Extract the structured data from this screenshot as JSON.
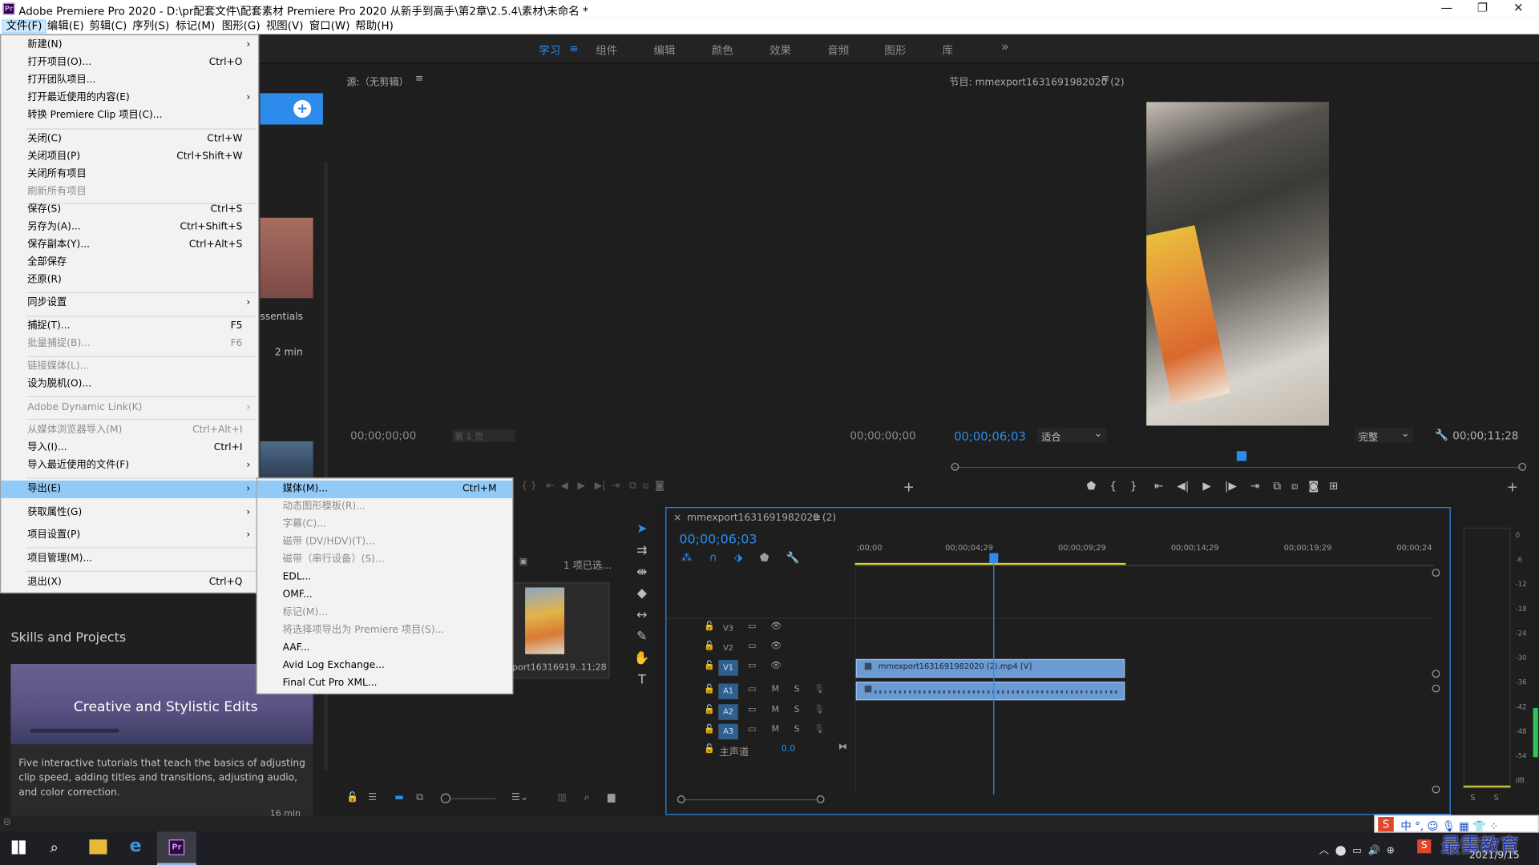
{
  "window": {
    "title": "Adobe Premiere Pro 2020 - D:\\pr配套文件\\配套素材 Premiere Pro 2020 从新手到高手\\第2章\\2.5.4\\素材\\未命名 *",
    "logo": "Pr",
    "minimize": "—",
    "maximize": "❐",
    "close": "✕"
  },
  "menubar": {
    "items": [
      "文件(F)",
      "编辑(E)",
      "剪辑(C)",
      "序列(S)",
      "标记(M)",
      "图形(G)",
      "视图(V)",
      "窗口(W)",
      "帮助(H)"
    ]
  },
  "workspaces": {
    "items": [
      "学习",
      "组件",
      "编辑",
      "颜色",
      "效果",
      "音频",
      "图形",
      "库"
    ],
    "active": "学习",
    "more": "»"
  },
  "learn": {
    "essentials": "ssentials",
    "min1": "2 min",
    "skills_title": "Skills and Projects",
    "card_title": "Creative and Stylistic Edits",
    "card_desc": "Five interactive tutorials that teach the basics of adjusting clip speed, adding titles and transitions, adjusting audio, and color correction.",
    "min2": "16 min"
  },
  "source": {
    "title": "源:（无剪辑）",
    "tc_left": "00;00;00;00",
    "page": "第 1 页",
    "tc_right": "00;00;00;00"
  },
  "program": {
    "title": "节目: mmexport1631691982020 (2)",
    "tc": "00;00;06;03",
    "fit": "适合",
    "quality": "完整",
    "duration": "00;00;11;28"
  },
  "project": {
    "selected": "1 项已选...",
    "clip_name": "port16316919...",
    "clip_dur": "11;28"
  },
  "timeline": {
    "tab": "mmexport1631691982020 (2)",
    "tc": "00;00;06;03",
    "ruler": [
      ";00;00",
      "00;00;04;29",
      "00;00;09;29",
      "00;00;14;29",
      "00;00;19;29",
      "00;00;24"
    ],
    "tracks": {
      "v3": "V3",
      "v2": "V2",
      "v1": "V1",
      "a1": "A1",
      "a2": "A2",
      "a3": "A3",
      "master": "主声道",
      "master_val": "0.0"
    },
    "clip_label": "mmexport1631691982020 (2).mp4 [V]"
  },
  "meters": {
    "scale": [
      "0",
      "-6",
      "-12",
      "-18",
      "-24",
      "-30",
      "-36",
      "-42",
      "-48",
      "-54",
      "dB"
    ],
    "s": "S"
  },
  "file_menu": {
    "items": [
      {
        "label": "新建(N)",
        "arrow": "›"
      },
      {
        "label": "打开项目(O)...",
        "shortcut": "Ctrl+O"
      },
      {
        "label": "打开团队项目..."
      },
      {
        "label": "打开最近使用的内容(E)",
        "arrow": "›"
      },
      {
        "label": "转换 Premiere Clip 项目(C)..."
      },
      {
        "label": "关闭(C)",
        "shortcut": "Ctrl+W"
      },
      {
        "label": "关闭项目(P)",
        "shortcut": "Ctrl+Shift+W"
      },
      {
        "label": "关闭所有项目"
      },
      {
        "label": "刷新所有项目"
      },
      {
        "label": "保存(S)",
        "shortcut": "Ctrl+S"
      },
      {
        "label": "另存为(A)...",
        "shortcut": "Ctrl+Shift+S"
      },
      {
        "label": "保存副本(Y)...",
        "shortcut": "Ctrl+Alt+S"
      },
      {
        "label": "全部保存"
      },
      {
        "label": "还原(R)"
      },
      {
        "label": "同步设置",
        "arrow": "›"
      },
      {
        "label": "捕捉(T)...",
        "shortcut": "F5"
      },
      {
        "label": "批量捕捉(B)...",
        "shortcut": "F6"
      },
      {
        "label": "链接媒体(L)..."
      },
      {
        "label": "设为脱机(O)..."
      },
      {
        "label": "Adobe Dynamic Link(K)",
        "arrow": "›"
      },
      {
        "label": "从媒体浏览器导入(M)",
        "shortcut": "Ctrl+Alt+I"
      },
      {
        "label": "导入(I)...",
        "shortcut": "Ctrl+I"
      },
      {
        "label": "导入最近使用的文件(F)",
        "arrow": "›"
      },
      {
        "label": "导出(E)",
        "arrow": "›"
      },
      {
        "label": "获取属性(G)",
        "arrow": "›"
      },
      {
        "label": "项目设置(P)",
        "arrow": "›"
      },
      {
        "label": "项目管理(M)..."
      },
      {
        "label": "退出(X)",
        "shortcut": "Ctrl+Q"
      }
    ]
  },
  "export_menu": {
    "items": [
      {
        "label": "媒体(M)...",
        "shortcut": "Ctrl+M"
      },
      {
        "label": "动态图形模板(R)..."
      },
      {
        "label": "字幕(C)..."
      },
      {
        "label": "磁带 (DV/HDV)(T)..."
      },
      {
        "label": "磁带（串行设备）(S)..."
      },
      {
        "label": "EDL..."
      },
      {
        "label": "OMF..."
      },
      {
        "label": "标记(M)..."
      },
      {
        "label": "将选择项导出为 Premiere 项目(S)..."
      },
      {
        "label": "AAF..."
      },
      {
        "label": "Avid Log Exchange..."
      },
      {
        "label": "Final Cut Pro XML..."
      }
    ]
  },
  "taskbar": {
    "ime": "中",
    "date": "2021/9/15",
    "watermark": "最需教育"
  },
  "colors": {
    "accent": "#2d8ceb",
    "menu_highlight": "#91c9f7",
    "clip_blue": "#6c9bd3"
  }
}
